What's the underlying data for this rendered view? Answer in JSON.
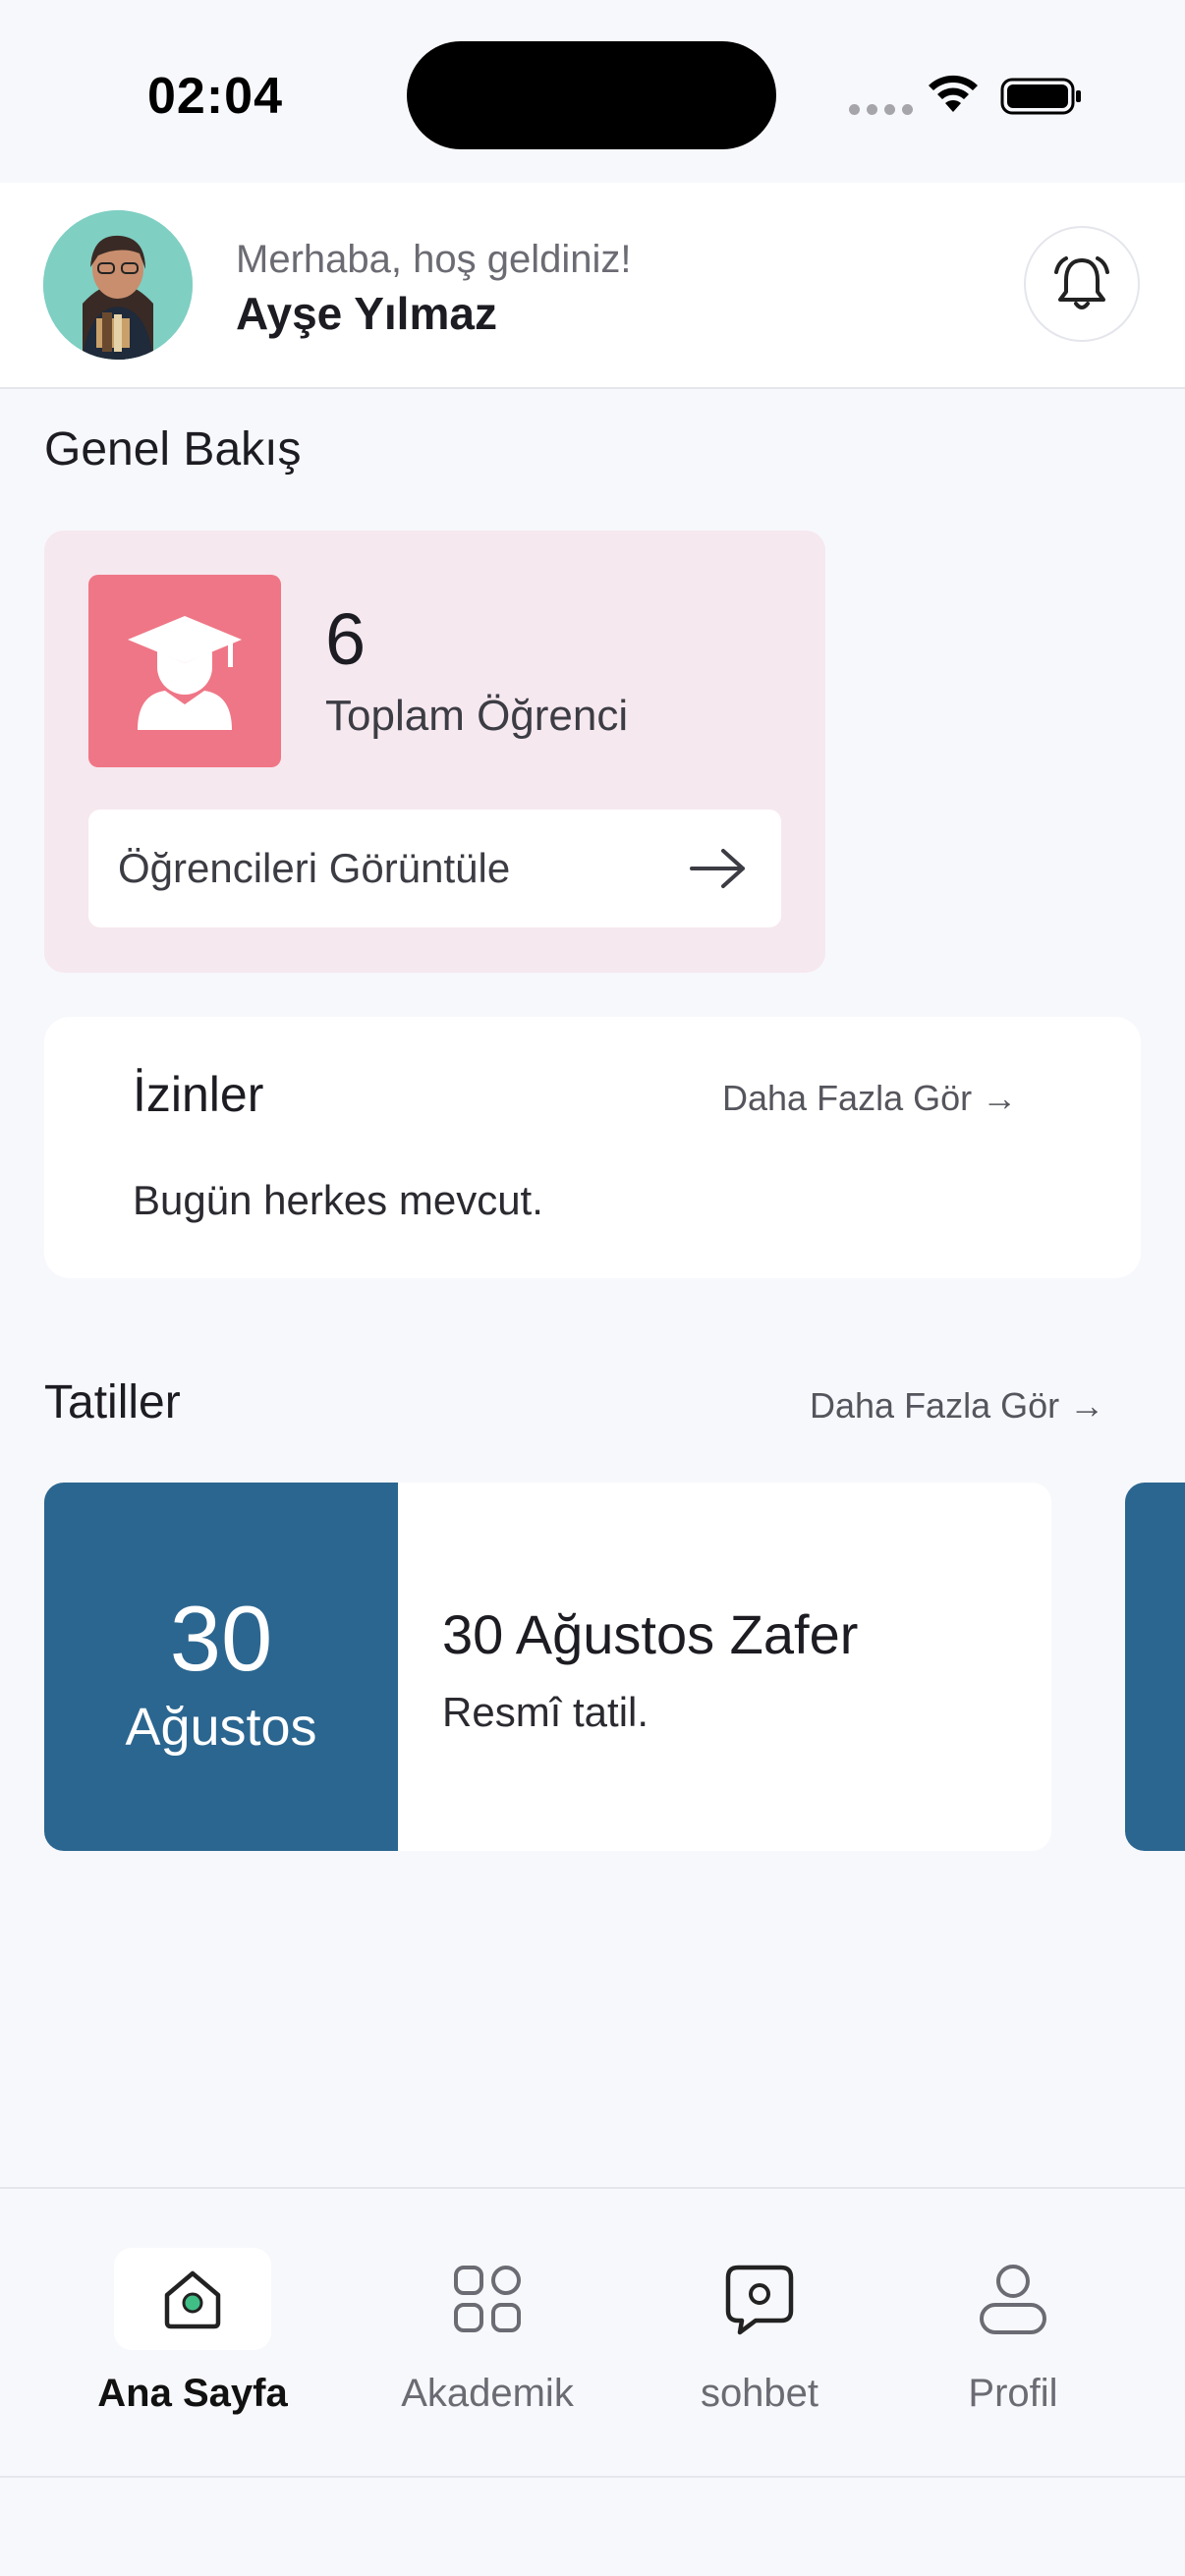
{
  "status_bar": {
    "time": "02:04"
  },
  "header": {
    "greeting": "Merhaba, hoş geldiniz!",
    "user_name": "Ayşe Yılmaz",
    "avatar_icon": "user-avatar",
    "notification_icon": "bell-icon"
  },
  "overview": {
    "title": "Genel Bakış",
    "total_students": "6",
    "total_students_label": "Toplam Öğrenci",
    "view_students_label": "Öğrencileri Görüntüle",
    "icon": "graduate-icon",
    "accent_color": "#ef7686"
  },
  "permissions": {
    "title": "İzinler",
    "see_more": "Daha Fazla Gör →",
    "message": "Bugün herkes mevcut."
  },
  "holidays": {
    "title": "Tatiller",
    "see_more": "Daha Fazla Gör →",
    "items": [
      {
        "day": "30",
        "month": "Ağustos",
        "name": "30 Ağustos Zafer",
        "type": "Resmî tatil."
      }
    ],
    "accent_color": "#2b6690"
  },
  "bottom_nav": {
    "items": [
      {
        "label": "Ana Sayfa",
        "icon": "home-icon",
        "active": true
      },
      {
        "label": "Akademik",
        "icon": "grid-icon",
        "active": false
      },
      {
        "label": "sohbet",
        "icon": "chat-icon",
        "active": false
      },
      {
        "label": "Profil",
        "icon": "profile-icon",
        "active": false
      }
    ]
  }
}
